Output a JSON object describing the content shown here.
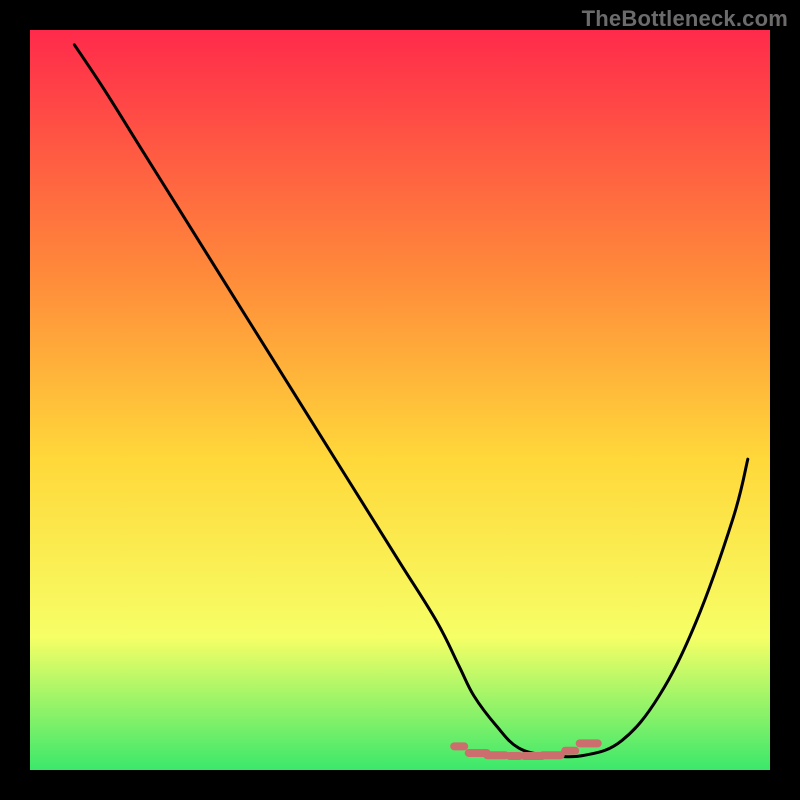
{
  "watermark": "TheBottleneck.com",
  "chart_data": {
    "type": "line",
    "title": "",
    "xlabel": "",
    "ylabel": "",
    "xlim": [
      0,
      100
    ],
    "ylim": [
      0,
      100
    ],
    "grid": false,
    "legend": false,
    "background_gradient": {
      "top": "#FF2A4B",
      "mid_upper": "#FF8A3A",
      "mid": "#FFD83A",
      "mid_lower": "#F6FF66",
      "bottom": "#3BE86B"
    },
    "series": [
      {
        "name": "bottleneck-curve",
        "x": [
          6,
          10,
          15,
          20,
          25,
          30,
          35,
          40,
          45,
          50,
          55,
          58,
          60,
          63,
          66,
          70,
          75,
          80,
          85,
          90,
          95,
          97
        ],
        "y": [
          98,
          92,
          84,
          76,
          68,
          60,
          52,
          44,
          36,
          28,
          20,
          14,
          10,
          6,
          3,
          2,
          2,
          4,
          10,
          20,
          34,
          42
        ]
      }
    ],
    "markers": {
      "name": "sweet-spot-dash",
      "x": [
        58,
        60.5,
        63,
        65.5,
        68,
        70.5,
        73,
        75.5
      ],
      "y": [
        3.2,
        2.3,
        2.0,
        1.9,
        1.9,
        2.0,
        2.6,
        3.6
      ],
      "color": "#CC6E6E",
      "style": "short-dashes"
    }
  }
}
